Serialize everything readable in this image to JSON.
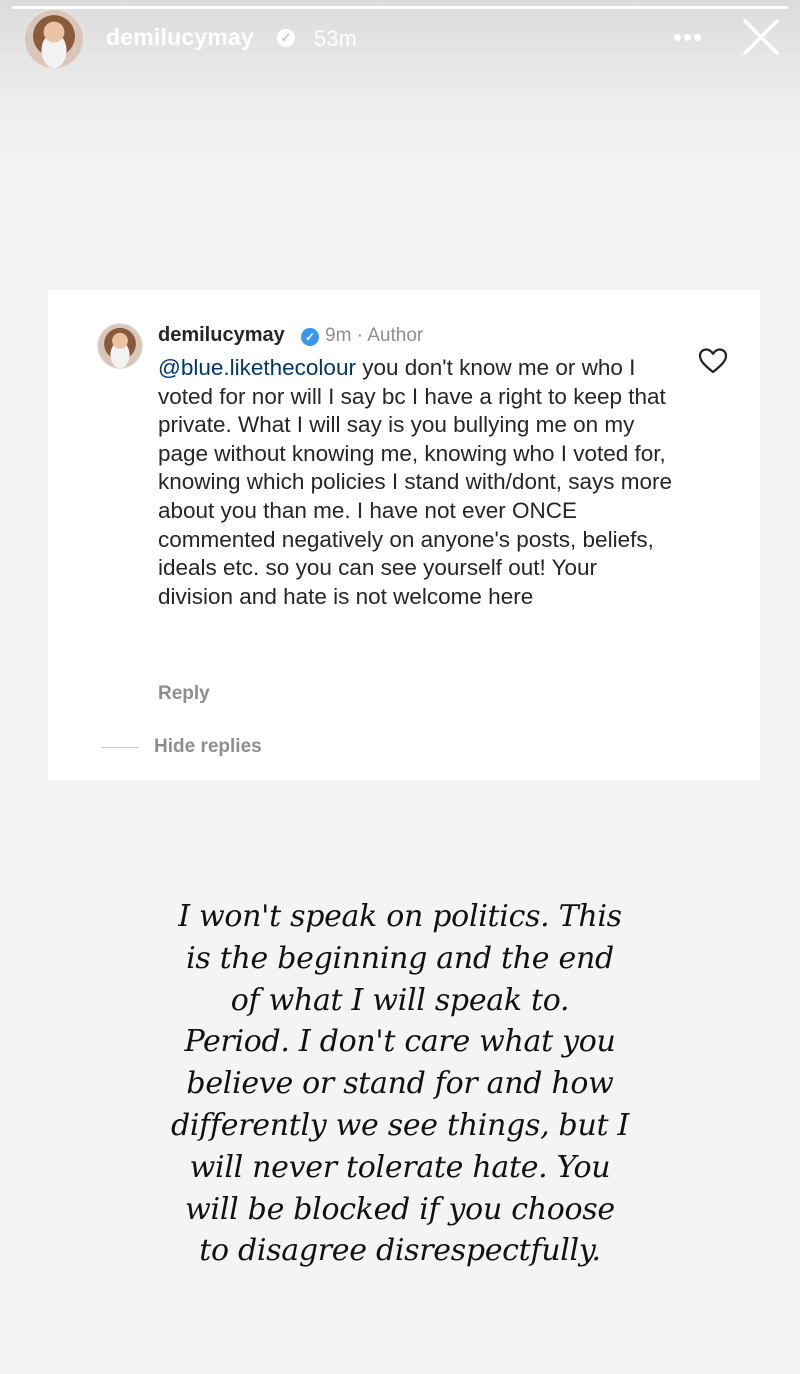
{
  "story": {
    "progress_fraction": 1.0,
    "username": "demilucymay",
    "verified_badge_icon": "verified-badge-icon",
    "time_ago": "53m",
    "more_icon": "more-horizontal-icon",
    "close_icon": "close-icon"
  },
  "comment": {
    "username": "demilucymay",
    "verified_badge_icon": "verified-badge-icon",
    "meta": "9m · Author",
    "mention": "@blue.likethecolour",
    "text": " you don't know me or who I voted for nor will I say bc I have a right to keep that private. What I will say is you bullying me on my page without knowing me, knowing who I voted for, knowing which policies I stand with/dont, says more about you than me. I have not ever ONCE commented negatively on anyone's posts, beliefs, ideals etc. so you can see yourself out! Your division and hate is not welcome here",
    "like_icon": "heart-outline-icon",
    "reply_label": "Reply",
    "hide_replies_label": "Hide replies"
  },
  "statement": {
    "lines": [
      "I won't speak on politics. This",
      "is the beginning and the end",
      "of what I will speak to.",
      "Period. I don't care what you",
      "believe or stand for and how",
      "differently we see things, but I",
      "will never tolerate hate. You",
      "will be blocked if you choose",
      "to disagree disrespectfully."
    ]
  },
  "colors": {
    "link": "#00376b",
    "verified": "#3897f0",
    "secondary_text": "#8e8e8e",
    "primary_text": "#262626"
  }
}
